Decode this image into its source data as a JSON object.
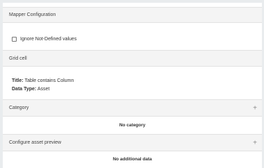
{
  "mapper": {
    "title": "Mapper Configuration"
  },
  "ignore_checkbox": {
    "label": "Ignore Not-Defined values",
    "checked": false
  },
  "grid_cell": {
    "title": "Grid cell",
    "title_label": "Title:",
    "title_value": "Table contains Column",
    "type_label": "Data Type:",
    "type_value": "Asset"
  },
  "category": {
    "title": "Category",
    "add_icon": "plus-icon",
    "empty_text": "No category"
  },
  "preview": {
    "title": "Configure asset preview",
    "add_icon": "plus-icon",
    "empty_text": "No additional data"
  }
}
